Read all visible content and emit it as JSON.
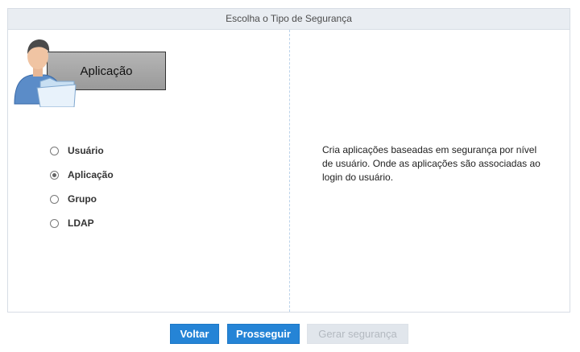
{
  "panel": {
    "title": "Escolha o Tipo de Segurança"
  },
  "selected_type": {
    "label": "Aplicação",
    "icon": "user-folder-icon"
  },
  "options": [
    {
      "label": "Usuário",
      "checked": false
    },
    {
      "label": "Aplicação",
      "checked": true
    },
    {
      "label": "Grupo",
      "checked": false
    },
    {
      "label": "LDAP",
      "checked": false
    }
  ],
  "description": "Cria aplicações baseadas em segurança por nível de usuário. Onde as aplicações são associadas ao login do usuário.",
  "buttons": {
    "back": "Voltar",
    "next": "Prosseguir",
    "generate": "Gerar segurança"
  },
  "colors": {
    "primary_button": "#2584d6",
    "disabled_button": "#e1e6ec",
    "header_bg": "#e9edf2"
  }
}
